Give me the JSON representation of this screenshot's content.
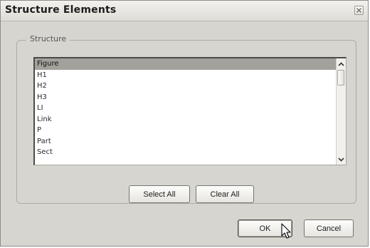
{
  "window": {
    "title": "Structure Elements"
  },
  "structure_group": {
    "legend": "Structure",
    "items": [
      "Figure",
      "H1",
      "H2",
      "H3",
      "LI",
      "Link",
      "P",
      "Part",
      "Sect"
    ],
    "selected_index": 0
  },
  "buttons": {
    "select_all": "Select All",
    "clear_all": "Clear All",
    "ok": "OK",
    "cancel": "Cancel"
  },
  "icons": {
    "close": "close-icon",
    "scroll_up": "chevron-up-icon",
    "scroll_down": "chevron-down-icon",
    "cursor": "mouse-pointer-icon"
  }
}
